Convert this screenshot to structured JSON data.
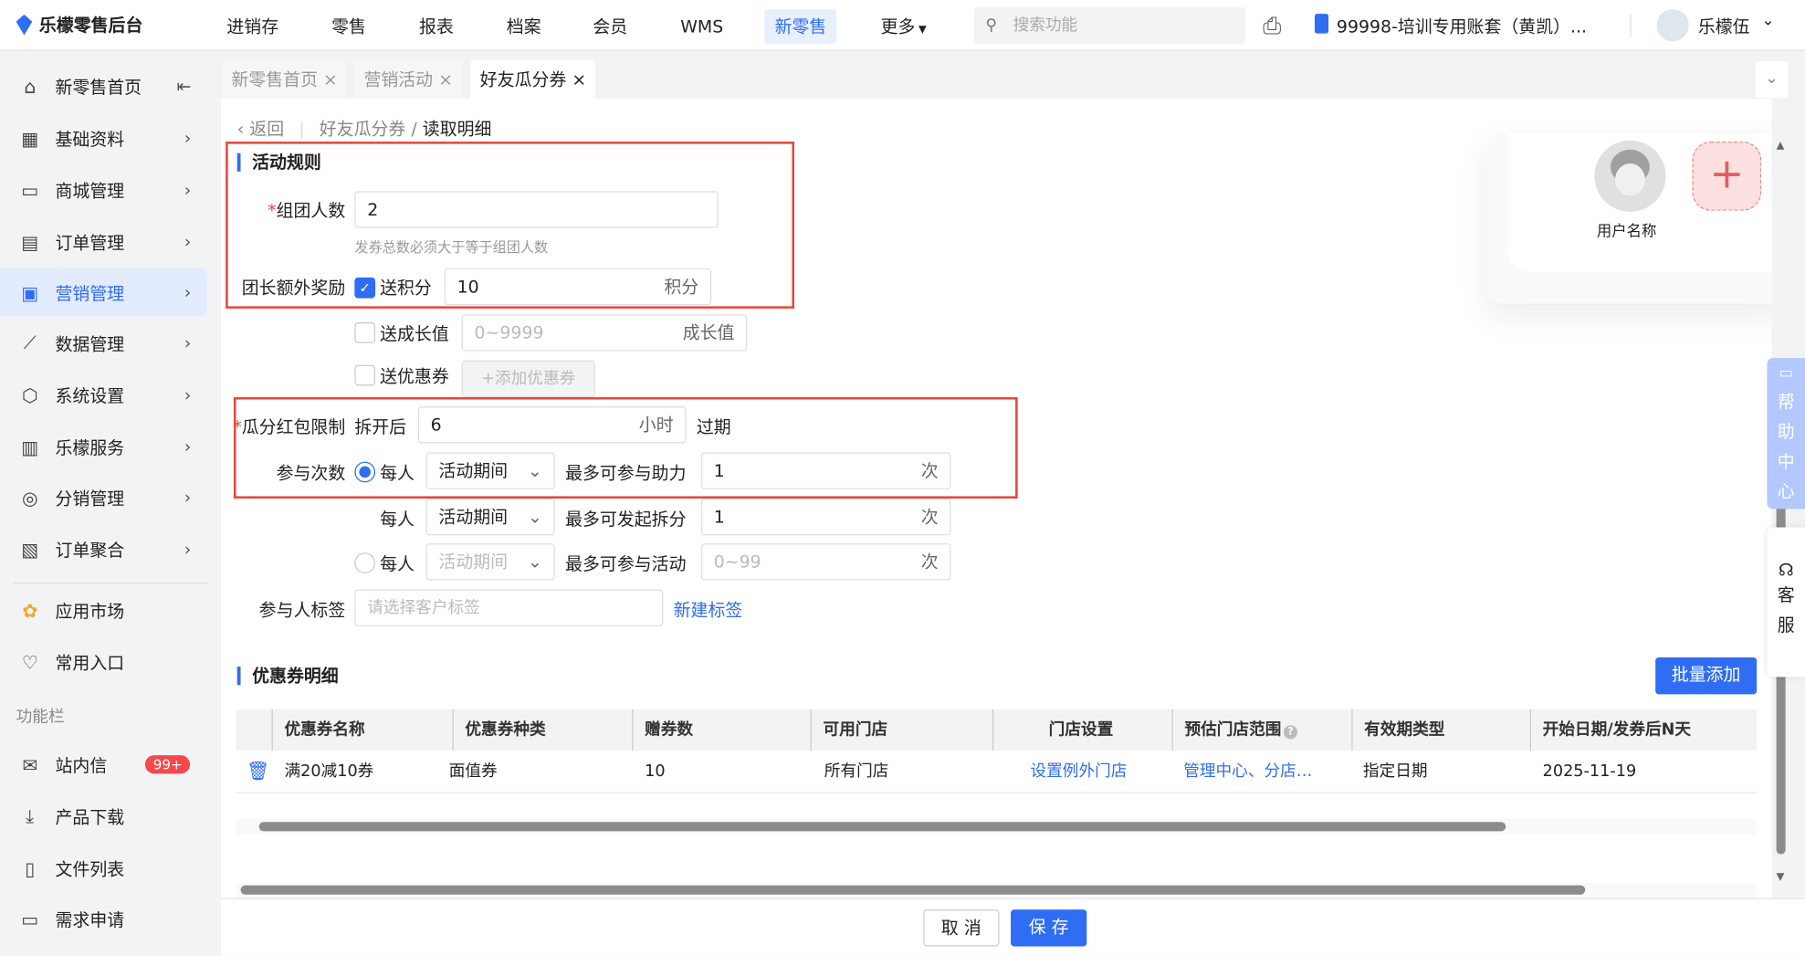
{
  "app": {
    "title": "乐檬零售后台"
  },
  "topnav": [
    "进销存",
    "零售",
    "报表",
    "档案",
    "会员",
    "WMS",
    "新零售",
    "更多"
  ],
  "search": {
    "placeholder": "搜索功能"
  },
  "account": {
    "name": "99998-培训专用账套（黄凯）...",
    "user": "乐檬伍"
  },
  "sidebar": {
    "items": [
      {
        "label": "新零售首页",
        "icon": "home-icon"
      },
      {
        "label": "基础资料",
        "icon": "grid-icon"
      },
      {
        "label": "商城管理",
        "icon": "store-icon"
      },
      {
        "label": "订单管理",
        "icon": "order-icon"
      },
      {
        "label": "营销管理",
        "icon": "marketing-icon"
      },
      {
        "label": "数据管理",
        "icon": "chart-icon"
      },
      {
        "label": "系统设置",
        "icon": "settings-icon"
      },
      {
        "label": "乐檬服务",
        "icon": "service-icon"
      },
      {
        "label": "分销管理",
        "icon": "distribution-icon"
      },
      {
        "label": "订单聚合",
        "icon": "aggregate-icon"
      }
    ],
    "extra": [
      {
        "label": "应用市场",
        "icon": "app-market-icon"
      },
      {
        "label": "常用入口",
        "icon": "heart-icon"
      }
    ],
    "section": "功能栏",
    "tools": [
      {
        "label": "站内信",
        "icon": "message-icon",
        "badge": "99+"
      },
      {
        "label": "产品下载",
        "icon": "download-icon"
      },
      {
        "label": "文件列表",
        "icon": "file-list-icon"
      },
      {
        "label": "需求申请",
        "icon": "request-icon"
      }
    ]
  },
  "tabs": [
    {
      "label": "新零售首页"
    },
    {
      "label": "营销活动"
    },
    {
      "label": "好友瓜分券"
    }
  ],
  "breadcrumb": {
    "back": "返回",
    "parent": "好友瓜分券",
    "current": "读取明细"
  },
  "rules": {
    "title": "活动规则",
    "group_size": {
      "label": "组团人数",
      "value": "2",
      "hint": "发券总数必须大于等于组团人数"
    },
    "leader_reward": {
      "label": "团长额外奖励",
      "points": {
        "label": "送积分",
        "checked": true,
        "value": "10",
        "suffix": "积分"
      },
      "growth": {
        "label": "送成长值",
        "checked": false,
        "placeholder": "0~9999",
        "suffix": "成长值"
      },
      "coupon": {
        "label": "送优惠券",
        "checked": false,
        "button": "+添加优惠券"
      }
    },
    "split_limit": {
      "label": "瓜分红包限制",
      "prefix": "拆开后",
      "value": "6",
      "suffix": "小时",
      "after": "过期"
    },
    "participation": {
      "label": "参与次数",
      "rows": [
        {
          "per": "每人",
          "period": "活动期间",
          "desc": "最多可参与助力",
          "value": "1",
          "suffix": "次",
          "selected": true
        },
        {
          "per": "每人",
          "period": "活动期间",
          "desc": "最多可发起拆分",
          "value": "1",
          "suffix": "次"
        },
        {
          "per": "每人",
          "period": "活动期间",
          "desc": "最多可参与活动",
          "placeholder": "0~99",
          "suffix": "次",
          "selected": false
        }
      ]
    },
    "tags": {
      "label": "参与人标签",
      "placeholder": "请选择客户标签",
      "link": "新建标签"
    }
  },
  "preview": {
    "user_label": "用户名称"
  },
  "coupons": {
    "title": "优惠券明细",
    "batch_add": "批量添加",
    "columns": [
      "优惠券名称",
      "优惠券种类",
      "赠券数",
      "可用门店",
      "门店设置",
      "预估门店范围",
      "有效期类型",
      "开始日期/发券后N天"
    ],
    "rows": [
      [
        "满20减10券",
        "面值券",
        "10",
        "所有门店",
        "设置例外门店",
        "管理中心、分店…",
        "指定日期",
        "2025-11-19"
      ]
    ]
  },
  "float": {
    "help": "帮助中心",
    "service": "客服"
  },
  "footer": {
    "cancel": "取 消",
    "save": "保 存"
  },
  "colors": {
    "accent": "#2f6df5",
    "highlight": "#e8453c"
  }
}
